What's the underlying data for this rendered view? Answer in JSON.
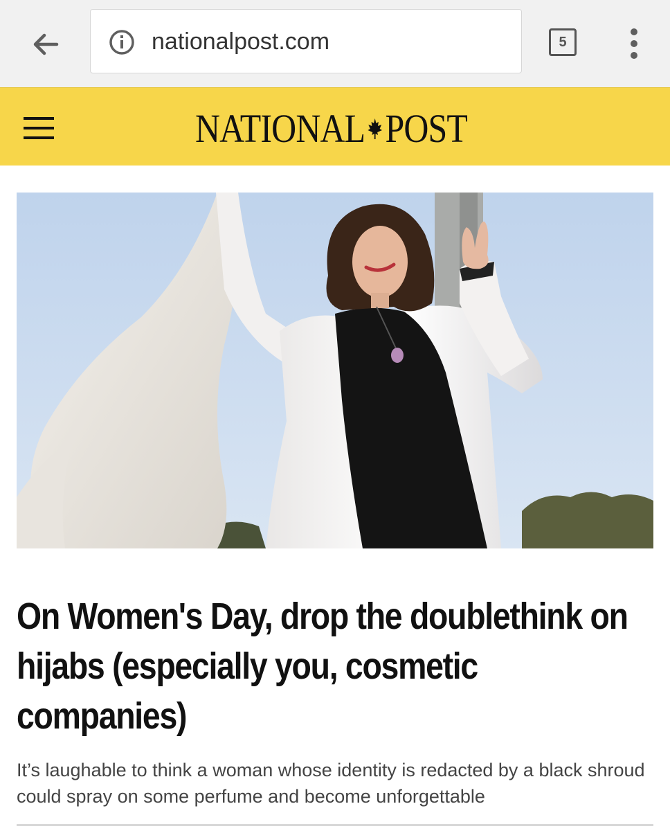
{
  "browser": {
    "url": "nationalpost.com",
    "tab_count": "5"
  },
  "site": {
    "logo_text_left": "NATIONAL",
    "logo_text_right": "POST",
    "header_color": "#f7d64a"
  },
  "article": {
    "headline": "On Women's Day, drop the doublethink on hijabs (especially you, cosmetic companies)",
    "deck": "It’s laughable to think a woman whose identity is redacted by a black shroud could spray on some perfume and become unforgettable"
  },
  "icons": {
    "back": "arrow-left-icon",
    "info": "info-icon",
    "tabs": "tab-switcher-icon",
    "menu": "overflow-menu-icon",
    "nav": "hamburger-menu-icon",
    "logo_mark": "maple-leaf-icon"
  }
}
